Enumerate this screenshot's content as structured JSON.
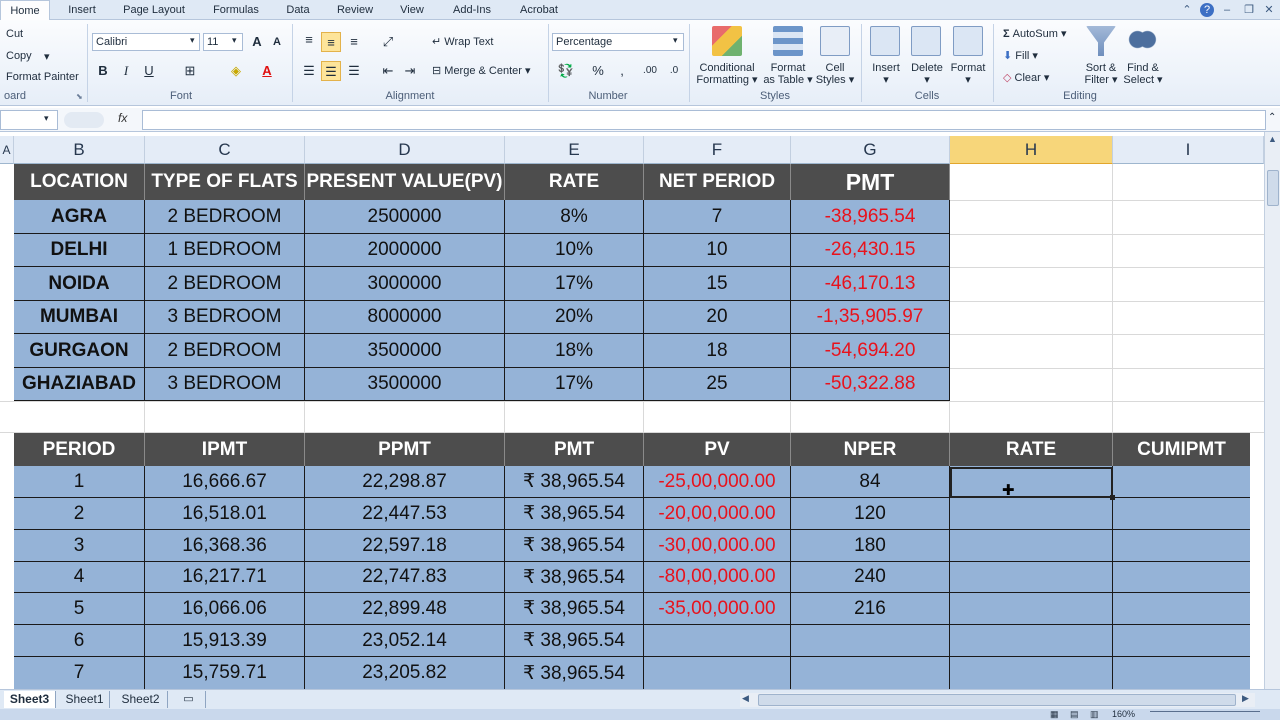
{
  "ribbon": {
    "tabs": [
      "Home",
      "Insert",
      "Page Layout",
      "Formulas",
      "Data",
      "Review",
      "View",
      "Add-Ins",
      "Acrobat"
    ],
    "clipboard": {
      "cut": "Cut",
      "copy": "Copy",
      "format_painter": "Format Painter",
      "label": "oard"
    },
    "font": {
      "name": "Calibri",
      "size": "11",
      "label": "Font"
    },
    "alignment": {
      "wrap_text": "Wrap Text",
      "merge_center": "Merge & Center",
      "label": "Alignment"
    },
    "number": {
      "format": "Percentage",
      "label": "Number"
    },
    "styles": {
      "conditional": [
        "Conditional",
        "Formatting"
      ],
      "format_table": [
        "Format",
        "as Table"
      ],
      "cell_styles": [
        "Cell",
        "Styles"
      ],
      "label": "Styles"
    },
    "cells": {
      "insert": "Insert",
      "delete": "Delete",
      "format": "Format",
      "label": "Cells"
    },
    "editing": {
      "autosum": "AutoSum",
      "fill": "Fill",
      "clear": "Clear",
      "sort_filter": [
        "Sort &",
        "Filter"
      ],
      "find_select": [
        "Find &",
        "Select"
      ],
      "label": "Editing"
    }
  },
  "formula_bar": {
    "fx": "fx",
    "value": ""
  },
  "columns": [
    "A",
    "B",
    "C",
    "D",
    "E",
    "F",
    "G",
    "H",
    "I"
  ],
  "table1": {
    "headers": [
      "LOCATION",
      "TYPE OF FLATS",
      "PRESENT VALUE(PV)",
      "RATE",
      "NET PERIOD",
      "PMT"
    ],
    "rows": [
      [
        "AGRA",
        "2 BEDROOM",
        "2500000",
        "8%",
        "7",
        "-38,965.54"
      ],
      [
        "DELHI",
        "1 BEDROOM",
        "2000000",
        "10%",
        "10",
        "-26,430.15"
      ],
      [
        "NOIDA",
        "2 BEDROOM",
        "3000000",
        "17%",
        "15",
        "-46,170.13"
      ],
      [
        "MUMBAI",
        "3 BEDROOM",
        "8000000",
        "20%",
        "20",
        "-1,35,905.97"
      ],
      [
        "GURGAON",
        "2 BEDROOM",
        "3500000",
        "18%",
        "18",
        "-54,694.20"
      ],
      [
        "GHAZIABAD",
        "3 BEDROOM",
        "3500000",
        "17%",
        "25",
        "-50,322.88"
      ]
    ]
  },
  "table2": {
    "headers": [
      "PERIOD",
      "IPMT",
      "PPMT",
      "PMT",
      "PV",
      "NPER",
      "RATE",
      "CUMIPMT"
    ],
    "rows": [
      [
        "1",
        "16,666.67",
        "22,298.87",
        "₹ 38,965.54",
        "-25,00,000.00",
        "84",
        "",
        ""
      ],
      [
        "2",
        "16,518.01",
        "22,447.53",
        "₹ 38,965.54",
        "-20,00,000.00",
        "120",
        "",
        ""
      ],
      [
        "3",
        "16,368.36",
        "22,597.18",
        "₹ 38,965.54",
        "-30,00,000.00",
        "180",
        "",
        ""
      ],
      [
        "4",
        "16,217.71",
        "22,747.83",
        "₹ 38,965.54",
        "-80,00,000.00",
        "240",
        "",
        ""
      ],
      [
        "5",
        "16,066.06",
        "22,899.48",
        "₹ 38,965.54",
        "-35,00,000.00",
        "216",
        "",
        ""
      ],
      [
        "6",
        "15,913.39",
        "23,052.14",
        "₹ 38,965.54",
        "",
        "",
        "",
        ""
      ],
      [
        "7",
        "15,759.71",
        "23,205.82",
        "₹ 38,965.54",
        "",
        "",
        "",
        ""
      ]
    ]
  },
  "sheets": [
    "Sheet3",
    "Sheet1",
    "Sheet2"
  ],
  "zoom": "160%",
  "colors": {
    "header_bg": "#4d4d4d",
    "data_bg": "#95b3d7",
    "negative": "#e8121c",
    "selected_col": "#f7d67a"
  }
}
